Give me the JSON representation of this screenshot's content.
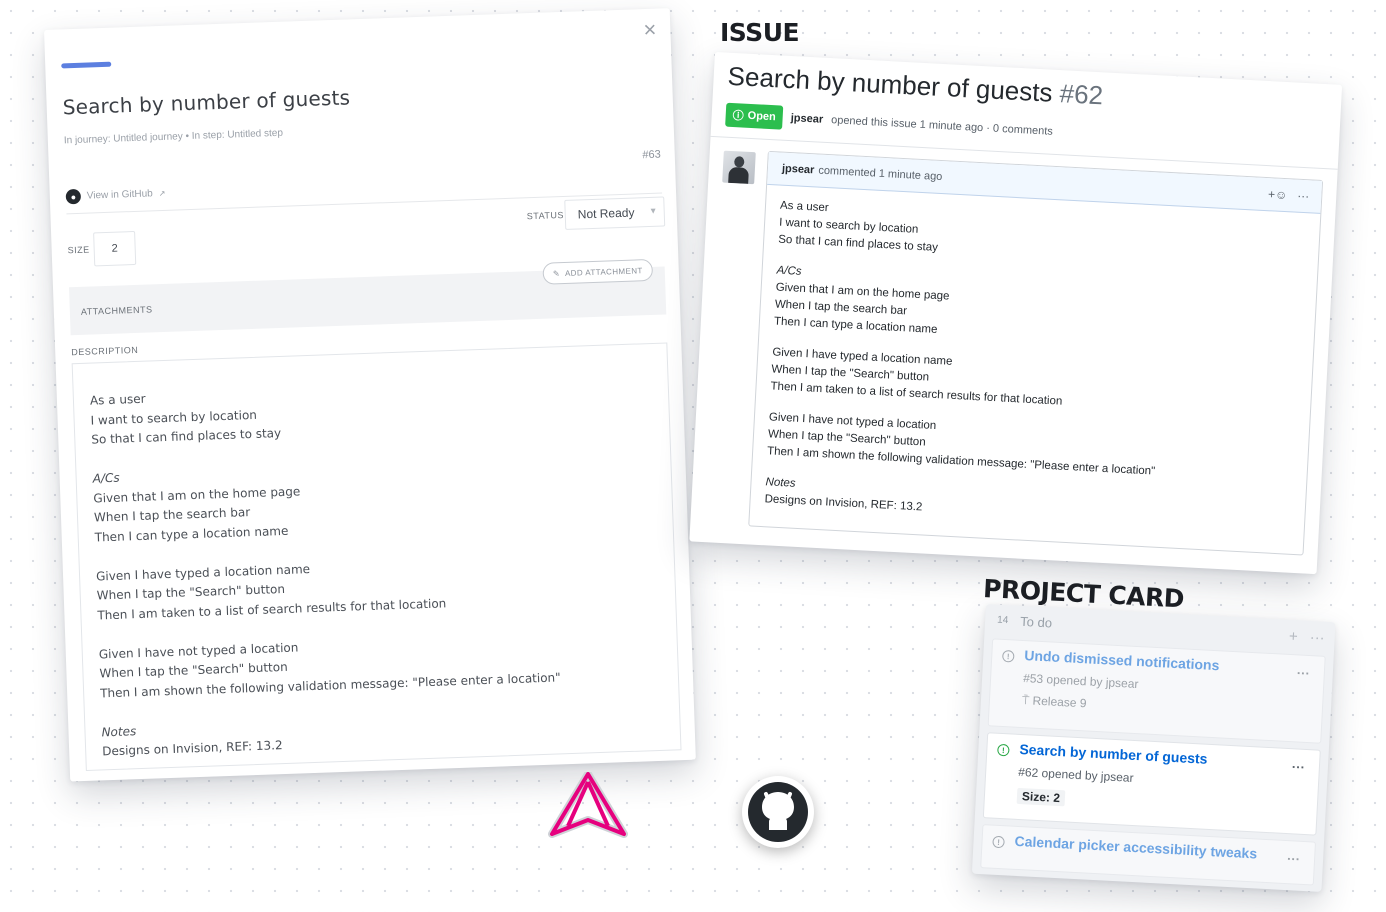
{
  "card": {
    "title": "Search by number of guests",
    "breadcrumb": "In journey: Untitled journey  •  In step: Untitled step",
    "number": "#63",
    "github_link": "View in GitHub",
    "status_label": "STATUS",
    "status_value": "Not Ready",
    "size_label": "SIZE",
    "size_value": "2",
    "attachments_label": "ATTACHMENTS",
    "add_attachment": "ADD ATTACHMENT",
    "description_label": "DESCRIPTION",
    "description": [
      [
        "As a user",
        "I want to search by location",
        "So that I can find places to stay"
      ],
      [
        "A/Cs",
        "Given that I am on the home page",
        "When I tap the search bar",
        "Then I can type a location name"
      ],
      [
        "Given I have typed a location name",
        "When I tap the \"Search\" button",
        "Then I am taken to a list of search results for that location"
      ],
      [
        "Given I have not typed a location",
        "When I tap the \"Search\" button",
        "Then I am shown the following validation message: \"Please enter a location\""
      ],
      [
        "Notes",
        "Designs on Invision, REF: 13.2"
      ]
    ]
  },
  "issue": {
    "section_label": "ISSUE",
    "title": "Search by number of guests",
    "number": "#62",
    "badge": "Open",
    "author": "jpsear",
    "meta": "opened this issue 1 minute ago · 0 comments",
    "comment_author": "jpsear",
    "comment_meta": "commented 1 minute ago",
    "reaction_icon": "+☺",
    "more_icon": "···",
    "body": [
      [
        "As a user",
        "I want to search by location",
        "So that I can find places to stay"
      ],
      [
        "A/Cs",
        "Given that I am on the home page",
        "When I tap the search bar",
        "Then I can type a location name"
      ],
      [
        "Given I have typed a location name",
        "When I tap the \"Search\" button",
        "Then I am taken to a list of search results for that location"
      ],
      [
        "Given I have not typed a location",
        "When I tap the \"Search\" button",
        "Then I am shown the following validation message: \"Please enter a location\""
      ],
      [
        "Notes",
        "Designs on Invision, REF: 13.2"
      ]
    ]
  },
  "project": {
    "section_label": "PROJECT CARD",
    "column_count": "14",
    "column_name": "To do",
    "cards": [
      {
        "title": "Undo dismissed notifications",
        "sub": "#53 opened by jpsear",
        "extra": "Release 9",
        "state": "faded"
      },
      {
        "title": "Search by number of guests",
        "sub": "#62 opened by jpsear",
        "extra": "Size: 2",
        "state": "open"
      },
      {
        "title": "Calendar picker accessibility tweaks",
        "sub": "",
        "extra": "",
        "state": "faded"
      }
    ]
  },
  "colors": {
    "accent": "#5c7fe0",
    "open_green": "#2cbe4e",
    "link_blue": "#0366d6",
    "brand_pink": "#e6007e"
  }
}
